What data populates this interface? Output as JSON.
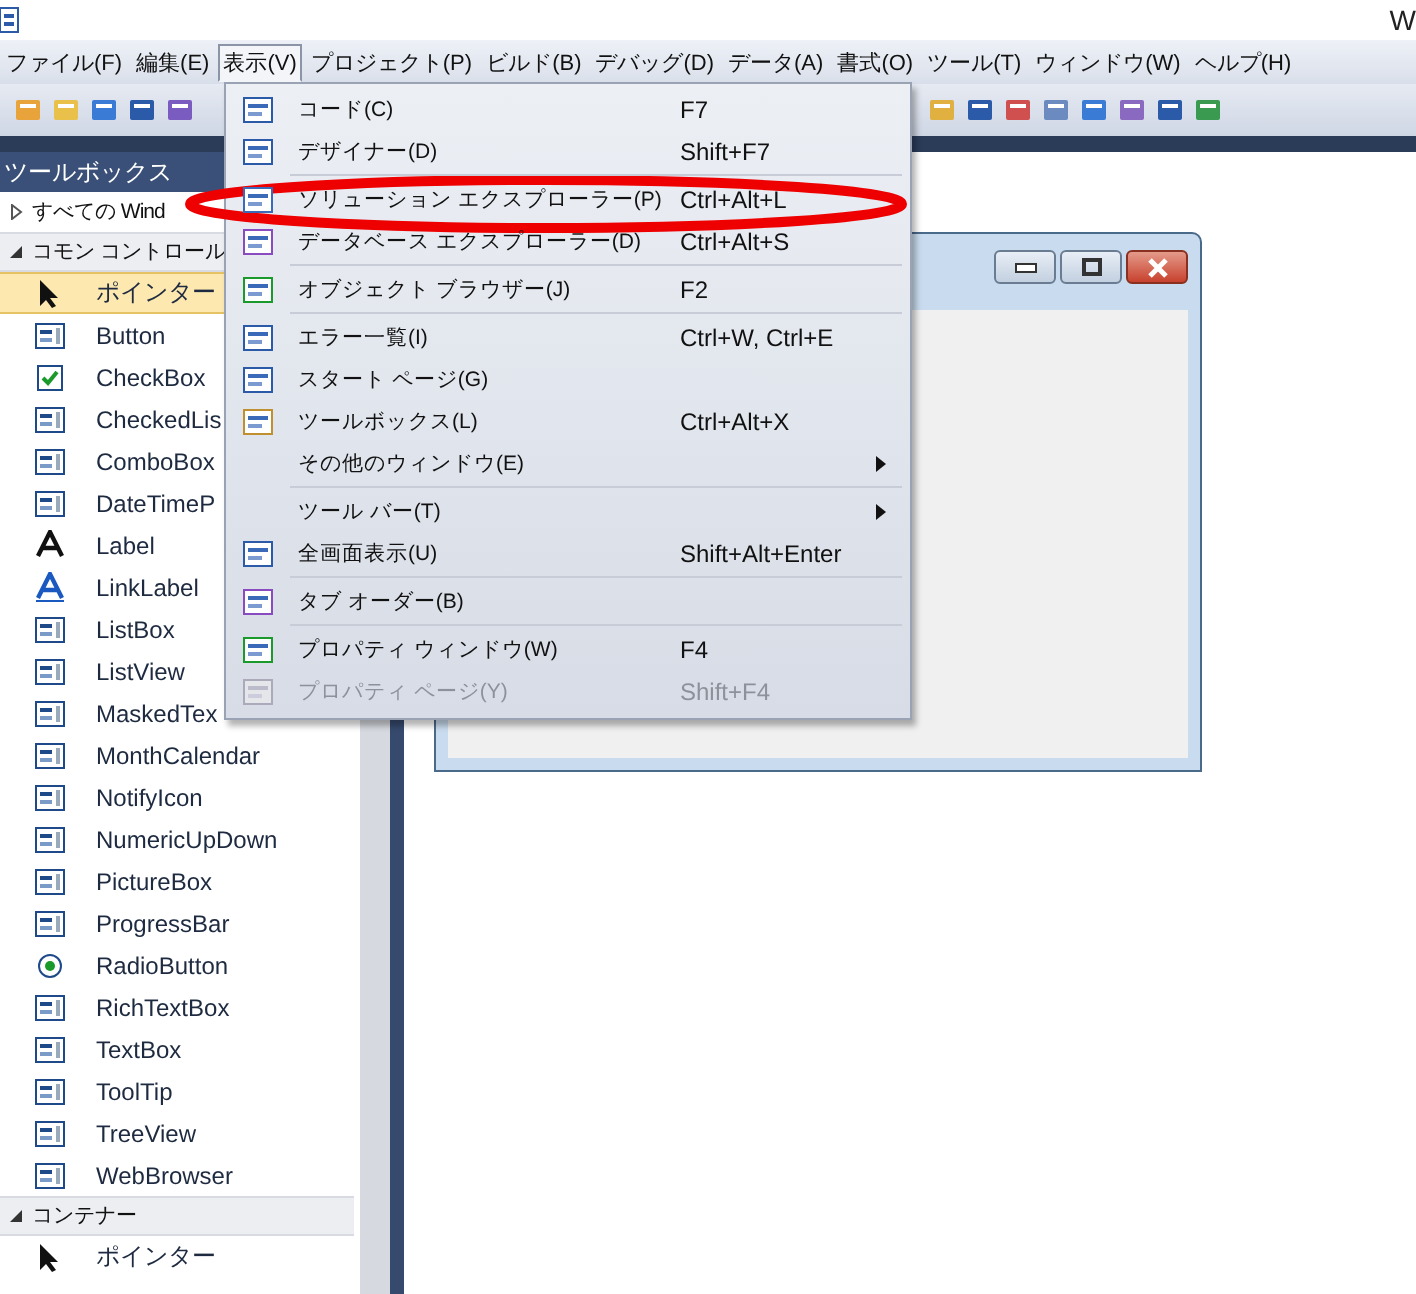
{
  "title_bar": {
    "title": "W"
  },
  "menu_bar": [
    {
      "label": "ファイル(F)",
      "selected": false
    },
    {
      "label": "編集(E)",
      "selected": false
    },
    {
      "label": "表示(V)",
      "selected": true
    },
    {
      "label": "プロジェクト(P)",
      "selected": false
    },
    {
      "label": "ビルド(B)",
      "selected": false
    },
    {
      "label": "デバッグ(D)",
      "selected": false
    },
    {
      "label": "データ(A)",
      "selected": false
    },
    {
      "label": "書式(O)",
      "selected": false
    },
    {
      "label": "ツール(T)",
      "selected": false
    },
    {
      "label": "ウィンドウ(W)",
      "selected": false
    },
    {
      "label": "ヘルプ(H)",
      "selected": false
    }
  ],
  "view_menu": [
    {
      "kind": "item",
      "label": "コード(C)",
      "shortcut": "F7",
      "icon": true,
      "submenu": false,
      "disabled": false
    },
    {
      "kind": "item",
      "label": "デザイナー(D)",
      "shortcut": "Shift+F7",
      "icon": true,
      "submenu": false,
      "disabled": false
    },
    {
      "kind": "separator"
    },
    {
      "kind": "item",
      "label": "ソリューション エクスプローラー(P)",
      "shortcut": "Ctrl+Alt+L",
      "icon": true,
      "submenu": false,
      "disabled": false
    },
    {
      "kind": "item",
      "label": "データベース エクスプローラー(D)",
      "shortcut": "Ctrl+Alt+S",
      "icon": true,
      "submenu": false,
      "disabled": false
    },
    {
      "kind": "separator"
    },
    {
      "kind": "item",
      "label": "オブジェクト ブラウザー(J)",
      "shortcut": "F2",
      "icon": true,
      "submenu": false,
      "disabled": false
    },
    {
      "kind": "separator"
    },
    {
      "kind": "item",
      "label": "エラー一覧(I)",
      "shortcut": "Ctrl+W, Ctrl+E",
      "icon": true,
      "submenu": false,
      "disabled": false
    },
    {
      "kind": "item",
      "label": "スタート ページ(G)",
      "icon": true,
      "submenu": false,
      "disabled": false
    },
    {
      "kind": "item",
      "label": "ツールボックス(L)",
      "shortcut": "Ctrl+Alt+X",
      "icon": true,
      "submenu": false,
      "disabled": false
    },
    {
      "kind": "item",
      "label": "その他のウィンドウ(E)",
      "icon": false,
      "submenu": true,
      "disabled": false
    },
    {
      "kind": "separator"
    },
    {
      "kind": "item",
      "label": "ツール バー(T)",
      "icon": false,
      "submenu": true,
      "disabled": false
    },
    {
      "kind": "item",
      "label": "全画面表示(U)",
      "shortcut": "Shift+Alt+Enter",
      "icon": true,
      "submenu": false,
      "disabled": false
    },
    {
      "kind": "separator"
    },
    {
      "kind": "item",
      "label": "タブ オーダー(B)",
      "icon": true,
      "submenu": false,
      "disabled": false
    },
    {
      "kind": "separator"
    },
    {
      "kind": "item",
      "label": "プロパティ ウィンドウ(W)",
      "shortcut": "F4",
      "icon": true,
      "submenu": false,
      "disabled": false
    },
    {
      "kind": "item",
      "label": "プロパティ ページ(Y)",
      "shortcut": "Shift+F4",
      "icon": true,
      "submenu": false,
      "disabled": true
    }
  ],
  "toolbox": {
    "title": "ツールボックス",
    "groups": [
      {
        "label": "すべての Wind",
        "expanded": false,
        "kind": "plain"
      },
      {
        "label": "コモン コントロール",
        "expanded": true,
        "kind": "category",
        "items": [
          {
            "label": "ポインター",
            "kind": "pointer",
            "selected": true
          },
          {
            "label": "Button",
            "kind": "control",
            "selected": false
          },
          {
            "label": "CheckBox",
            "kind": "check",
            "selected": false
          },
          {
            "label": "CheckedLis",
            "kind": "control",
            "selected": false
          },
          {
            "label": "ComboBox",
            "kind": "control",
            "selected": false
          },
          {
            "label": "DateTimeP",
            "kind": "control",
            "selected": false
          },
          {
            "label": "Label",
            "kind": "letter",
            "selected": false
          },
          {
            "label": "LinkLabel",
            "kind": "letter",
            "selected": false
          },
          {
            "label": "ListBox",
            "kind": "control",
            "selected": false
          },
          {
            "label": "ListView",
            "kind": "control",
            "selected": false
          },
          {
            "label": "MaskedTex",
            "kind": "control",
            "selected": false
          },
          {
            "label": "MonthCalendar",
            "kind": "control",
            "selected": false
          },
          {
            "label": "NotifyIcon",
            "kind": "control",
            "selected": false
          },
          {
            "label": "NumericUpDown",
            "kind": "control",
            "selected": false
          },
          {
            "label": "PictureBox",
            "kind": "control",
            "selected": false
          },
          {
            "label": "ProgressBar",
            "kind": "control",
            "selected": false
          },
          {
            "label": "RadioButton",
            "kind": "radio",
            "selected": false
          },
          {
            "label": "RichTextBox",
            "kind": "control",
            "selected": false
          },
          {
            "label": "TextBox",
            "kind": "control",
            "selected": false
          },
          {
            "label": "ToolTip",
            "kind": "control",
            "selected": false
          },
          {
            "label": "TreeView",
            "kind": "control",
            "selected": false
          },
          {
            "label": "WebBrowser",
            "kind": "control",
            "selected": false
          }
        ]
      },
      {
        "label": "コンテナー",
        "expanded": true,
        "kind": "category",
        "items": [
          {
            "label": "ポインター",
            "kind": "pointer",
            "selected": false
          }
        ]
      }
    ]
  }
}
